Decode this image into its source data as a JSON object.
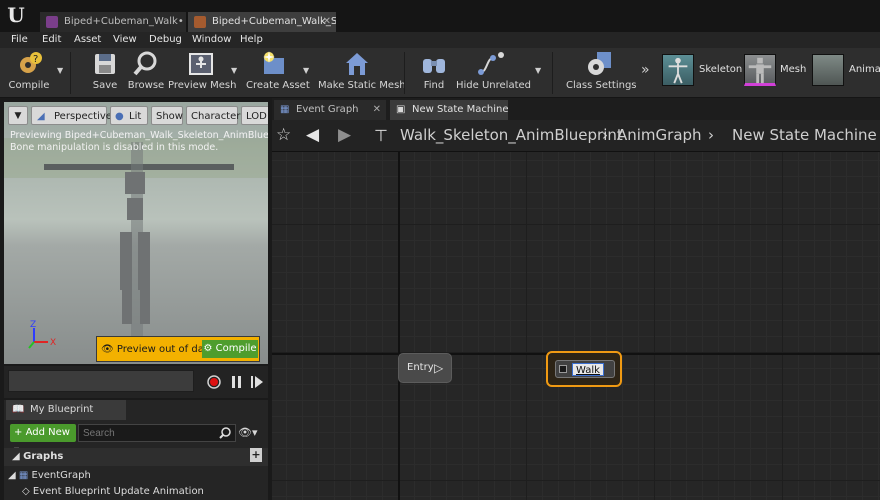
{
  "doc_tabs": [
    {
      "label": "Biped+Cubeman_Walk•",
      "active": false
    },
    {
      "label": "Biped+Cubeman_Walk_Sk",
      "active": true
    }
  ],
  "menu": [
    "File",
    "Edit",
    "Asset",
    "View",
    "Debug",
    "Window",
    "Help"
  ],
  "toolbar": {
    "compile": "Compile",
    "save": "Save",
    "browse": "Browse",
    "preview_mesh": "Preview Mesh",
    "create_asset": "Create Asset",
    "make_static_mesh": "Make Static Mesh",
    "find": "Find",
    "hide_unrelated": "Hide Unrelated",
    "class_settings": "Class Settings",
    "skeleton": "Skeleton",
    "mesh": "Mesh",
    "animation": "Animat"
  },
  "viewport": {
    "perspective": "Perspective",
    "lit": "Lit",
    "show": "Show",
    "character": "Character",
    "lod": "LOD A",
    "note1": "Previewing Biped+Cubeman_Walk_Skeleton_AnimBlueprint_C",
    "note2": "Bone manipulation is disabled in this mode.",
    "preview_out_of_date": "Preview out of date",
    "compile": "Compile",
    "axis_z": "Z",
    "axis_x": "X"
  },
  "my_blueprint": {
    "tab": "My Blueprint",
    "add_new": "Add New",
    "search_placeholder": "Search",
    "graphs": "Graphs",
    "event_graph": "EventGraph",
    "event_item": "Event Blueprint Update Animation"
  },
  "graph_tabs": [
    {
      "label": "Event Graph",
      "active": false
    },
    {
      "label": "New State Machine",
      "active": true
    }
  ],
  "breadcrumb": {
    "part1": "Walk_Skeleton_AnimBlueprint",
    "part2": "AnimGraph",
    "part3": "New State Machine"
  },
  "nodes": {
    "entry": "Entry",
    "state": "Walk"
  },
  "colors": {
    "state_border": "#f09a13",
    "add_new": "#4a9a2c",
    "warning": "#f3b100"
  }
}
